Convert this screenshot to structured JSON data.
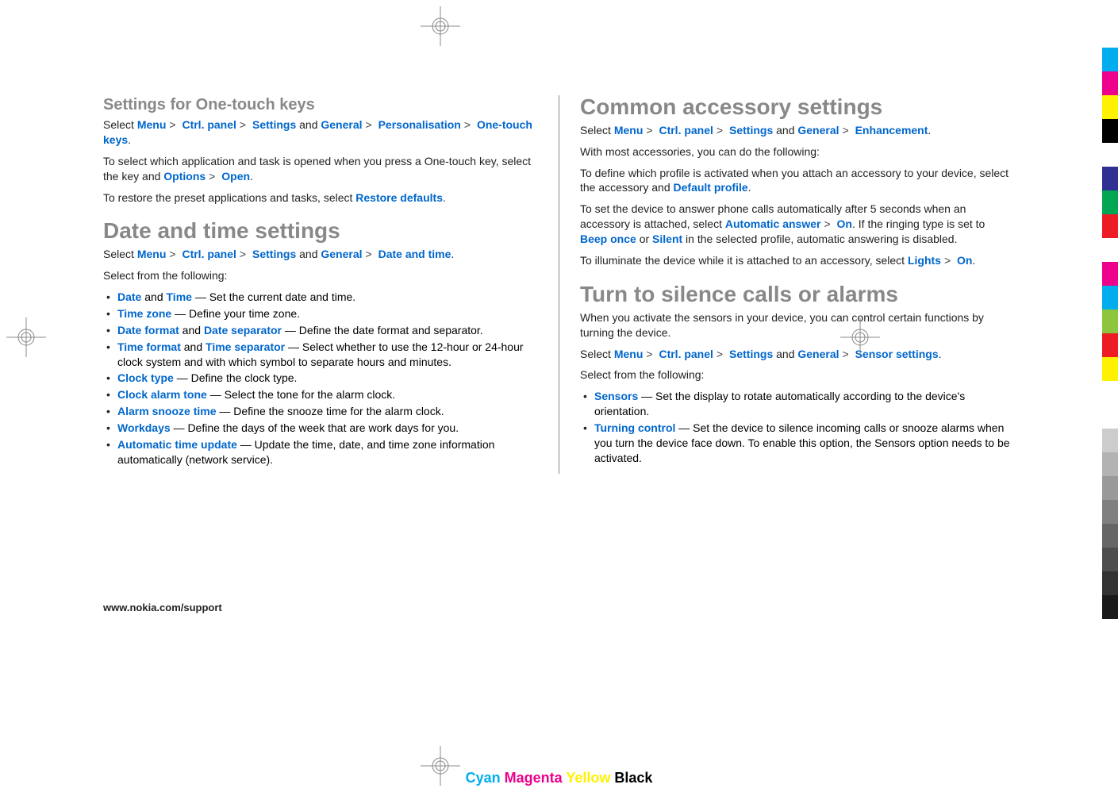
{
  "leftColumn": {
    "section1": {
      "heading": "Settings for One-touch keys",
      "nav": {
        "prefix": "Select ",
        "items": [
          "Menu",
          "Ctrl. panel",
          "Settings"
        ],
        "and": " and ",
        "items2": [
          "General",
          "Personalisation",
          "One-touch keys"
        ],
        "suffix": "."
      },
      "p1_a": "To select which application and task is opened when you press a One-touch key, select the key and ",
      "p1_link1": "Options",
      "p1_link2": "Open",
      "p1_suffix": ".",
      "p2_a": "To restore the preset applications and tasks, select ",
      "p2_link": "Restore defaults",
      "p2_suffix": "."
    },
    "section2": {
      "heading": "Date and time settings",
      "nav": {
        "prefix": "Select ",
        "items": [
          "Menu",
          "Ctrl. panel",
          "Settings"
        ],
        "and": " and ",
        "items2": [
          "General",
          "Date and time"
        ],
        "suffix": "."
      },
      "selectFrom": "Select from the following:",
      "items": [
        {
          "links": [
            "Date",
            "Time"
          ],
          "joiner": " and ",
          "text": " — Set the current date and time."
        },
        {
          "links": [
            "Time zone"
          ],
          "text": "  — Define your time zone."
        },
        {
          "links": [
            "Date format",
            "Date separator"
          ],
          "joiner": " and ",
          "text": " — Define the date format and separator."
        },
        {
          "links": [
            "Time format",
            "Time separator"
          ],
          "joiner": " and ",
          "text": " — Select whether to use the 12-hour or 24-hour clock system and with which symbol to separate hours and minutes."
        },
        {
          "links": [
            "Clock type"
          ],
          "text": "  — Define the clock type."
        },
        {
          "links": [
            "Clock alarm tone"
          ],
          "text": "  — Select the tone for the alarm clock."
        },
        {
          "links": [
            "Alarm snooze time"
          ],
          "text": "  — Define the snooze time for the alarm clock."
        },
        {
          "links": [
            "Workdays"
          ],
          "text": "  — Define the days of the week that are work days for you."
        },
        {
          "links": [
            "Automatic time update"
          ],
          "text": "  — Update the time, date, and time zone information automatically (network service)."
        }
      ]
    }
  },
  "rightColumn": {
    "section1": {
      "heading": "Common accessory settings",
      "nav": {
        "prefix": "Select ",
        "items": [
          "Menu",
          "Ctrl. panel",
          "Settings"
        ],
        "and": " and ",
        "items2": [
          "General",
          "Enhancement"
        ],
        "suffix": "."
      },
      "p1": "With most accessories, you can do the following:",
      "p2_a": "To define which profile is activated when you attach an accessory to your device, select the accessory and ",
      "p2_link": "Default profile",
      "p2_suffix": ".",
      "p3_a": "To set the device to answer phone calls automatically after 5 seconds when an accessory is attached, select ",
      "p3_link1": "Automatic answer",
      "p3_link2": "On",
      "p3_mid": ". If the ringing type is set to ",
      "p3_link3": "Beep once",
      "p3_or": " or ",
      "p3_link4": "Silent",
      "p3_suffix": " in the selected profile, automatic answering is disabled.",
      "p4_a": "To illuminate the device while it is attached to an accessory, select ",
      "p4_link1": "Lights",
      "p4_link2": "On",
      "p4_suffix": "."
    },
    "section2": {
      "heading": "Turn to silence calls or alarms",
      "p1": "When you activate the sensors in your device, you can control certain functions by turning the device.",
      "nav": {
        "prefix": "Select ",
        "items": [
          "Menu",
          "Ctrl. panel",
          "Settings"
        ],
        "and": " and ",
        "items2": [
          "General",
          "Sensor settings"
        ],
        "suffix": "."
      },
      "selectFrom": "Select from the following:",
      "items": [
        {
          "links": [
            "Sensors"
          ],
          "text": "  — Set the display to rotate automatically according to the device's orientation."
        },
        {
          "links": [
            "Turning control"
          ],
          "text": "  — Set the device to silence incoming calls or snooze alarms when you turn the device face down. To enable this option, the Sensors option needs to be activated."
        }
      ]
    }
  },
  "footer": "www.nokia.com/support",
  "colorLabels": {
    "cyan": "Cyan",
    "magenta": "Magenta",
    "yellow": "Yellow",
    "black": "Black"
  },
  "colorBarsTop": [
    "#00aeef",
    "#ec008c",
    "#fff200",
    "#000000",
    "#ffffff",
    "#2e3192",
    "#00a651",
    "#ed1c24"
  ],
  "colorBarsBottom": [
    "#ec008c",
    "#00aeef",
    "#8dc63e",
    "#ed1c24",
    "#fff200",
    "#ffffff"
  ],
  "grayBars": [
    "#cccccc",
    "#b3b3b3",
    "#999999",
    "#808080",
    "#666666",
    "#4d4d4d",
    "#333333",
    "#1a1a1a"
  ]
}
